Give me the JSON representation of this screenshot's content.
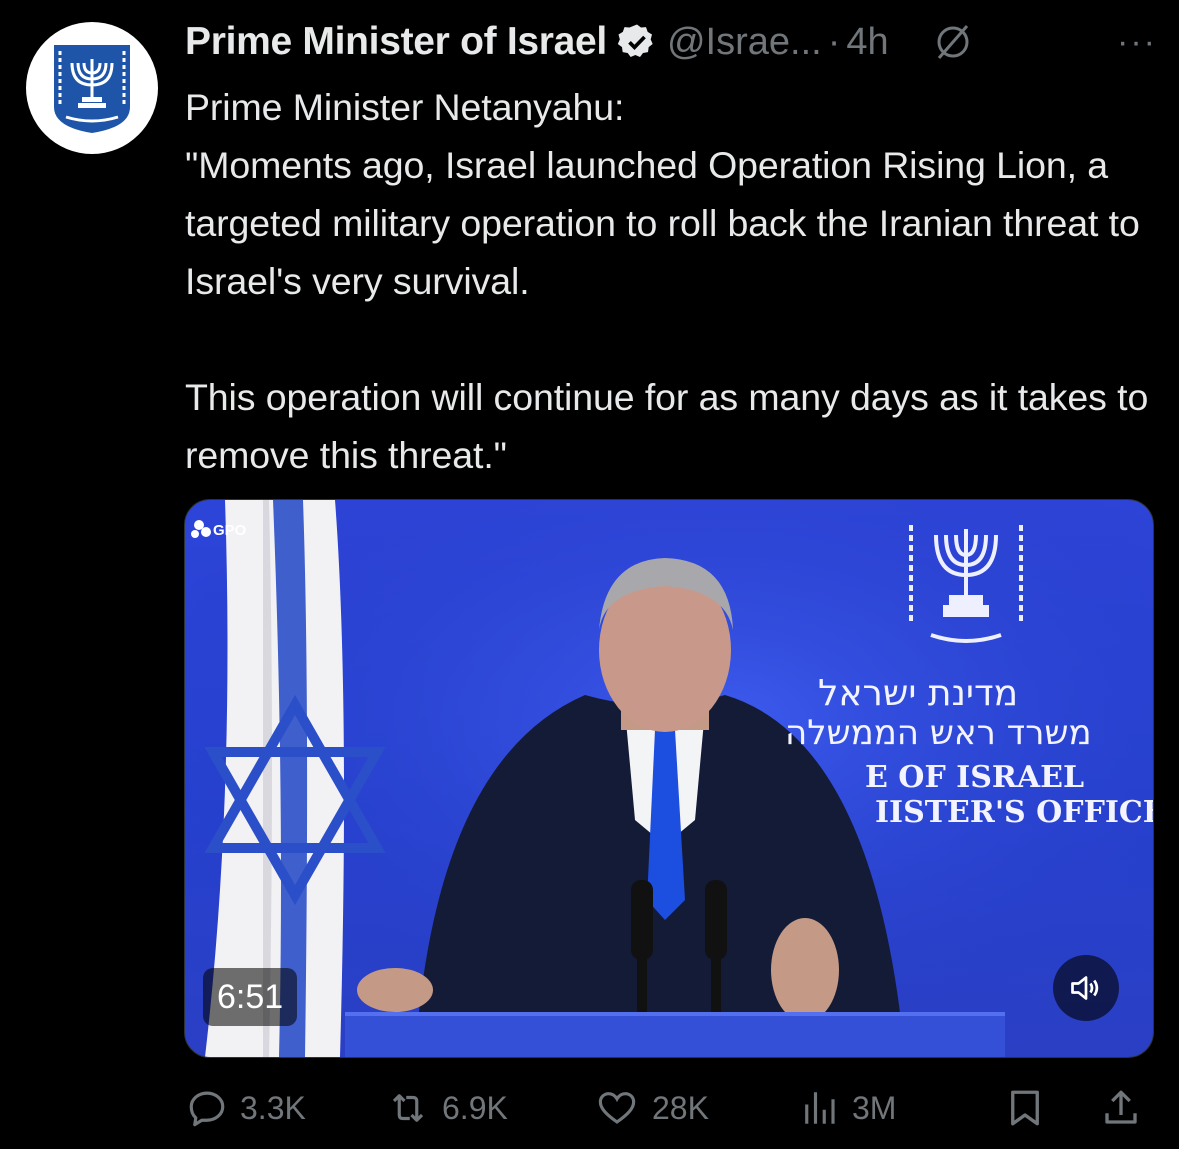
{
  "author": {
    "name": "Prime Minister of Israel",
    "handle": "@Israe...",
    "separator": "·",
    "time": "4h",
    "more_label": "···"
  },
  "tweet": {
    "line1": "Prime Minister Netanyahu:",
    "line2": "\"Moments ago, Israel launched Operation Rising Lion, a targeted military operation to roll back the Iranian threat to Israel's very survival.",
    "line3": "This operation will continue for as many days as it takes to remove this threat.\""
  },
  "media": {
    "watermark": "GPO",
    "duration": "6:51",
    "backdrop_text": {
      "hebrew_line1": "מדינת ישראל",
      "hebrew_line2": "משרד ראש הממשלה",
      "english_line1": "E OF ISRAEL",
      "english_line2": "IISTER'S OFFICE"
    }
  },
  "actions": {
    "replies": "3.3K",
    "reposts": "6.9K",
    "likes": "28K",
    "views": "3M"
  },
  "colors": {
    "background": "#000000",
    "text": "#e7e9ea",
    "muted": "#71767b",
    "verified": "#1d9bf0",
    "stage_blue": "#2a44d4"
  },
  "icons": [
    "verified-badge-icon",
    "grok-icon",
    "more-icon",
    "reply-icon",
    "repost-icon",
    "like-icon",
    "views-icon",
    "bookmark-icon",
    "share-icon",
    "volume-icon"
  ]
}
